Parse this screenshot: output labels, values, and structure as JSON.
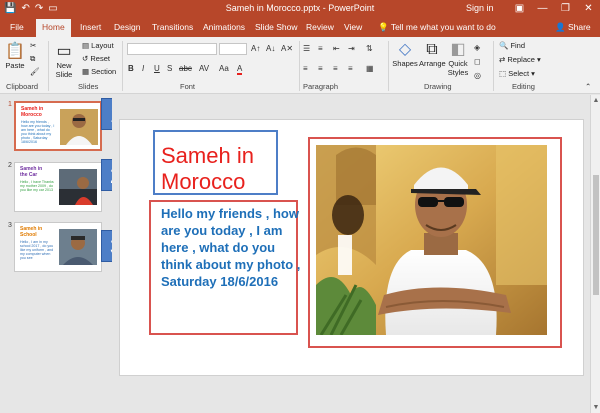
{
  "window": {
    "title": "Sameh in Morocco.pptx - PowerPoint",
    "sign_in": "Sign in",
    "qat": {
      "save": "💾",
      "undo": "↶",
      "redo": "↷",
      "present": "▭"
    },
    "controls": {
      "ribbon_options": "▣",
      "minimize": "—",
      "restore": "❐",
      "close": "✕"
    }
  },
  "tabs": [
    "File",
    "Home",
    "Insert",
    "Design",
    "Transitions",
    "Animations",
    "Slide Show",
    "Review",
    "View"
  ],
  "active_tab": "Home",
  "tell_me": "Tell me what you want to do",
  "share": "Share",
  "ribbon": {
    "clipboard": {
      "label": "Clipboard",
      "paste": "Paste"
    },
    "slides": {
      "label": "Slides",
      "new_slide": "New\nSlide",
      "layout": "Layout",
      "reset": "Reset",
      "section": "Section"
    },
    "font": {
      "label": "Font",
      "bold": "B",
      "italic": "I",
      "underline": "U",
      "strike": "S",
      "shadow": "abc",
      "spacing": "AV",
      "case": "Aa",
      "font_color": "A"
    },
    "paragraph": {
      "label": "Paragraph"
    },
    "drawing": {
      "label": "Drawing",
      "shapes": "Shapes",
      "arrange": "Arrange",
      "quick_styles": "Quick\nStyles"
    },
    "editing": {
      "label": "Editing",
      "find": "Find",
      "replace": "Replace",
      "select": "Select"
    }
  },
  "slides": [
    {
      "number": "1",
      "title": "Sameh in Morocco",
      "body": "Hello my friends , how are you today , I am here , what do you think about my photo , Saturday 18/6/2016",
      "title_color": "#e8211d",
      "body_color": "#1e6fb8"
    },
    {
      "number": "2",
      "title": "Sameh in the Car",
      "body": "Hello , I have Thanks my mother 2009 , do you like my car 2013",
      "title_color": "#7030a0",
      "body_color": "#2e9e3e"
    },
    {
      "number": "3",
      "title": "Sameh in School",
      "body": "Hello , I am in my school 2017 , do you like my uniform , and my computer when you see",
      "title_color": "#e07b00",
      "body_color": "#2e6eb5"
    }
  ],
  "active_slide": 1,
  "callouts": [
    "1",
    "2",
    "3"
  ],
  "current_slide": {
    "title": "Sameh in Morocco",
    "body": "Hello my friends , how are you today , I am here , what do you think about my photo , Saturday 18/6/2016",
    "title_color": "#e8211d",
    "body_color": "#1e6fb8",
    "photo": "man-sunglasses-cap-crossed-arms"
  },
  "colors": {
    "brand": "#b7472a",
    "callout": "#4d7ec7",
    "box_red": "#d9534f",
    "box_blue": "#4d7ec7"
  },
  "icons": {
    "cut": "✂",
    "copy": "⧉",
    "format_painter": "🖌",
    "find": "🔍",
    "replace": "⇄",
    "select": "⬚",
    "bulb": "💡",
    "share": "👤"
  }
}
